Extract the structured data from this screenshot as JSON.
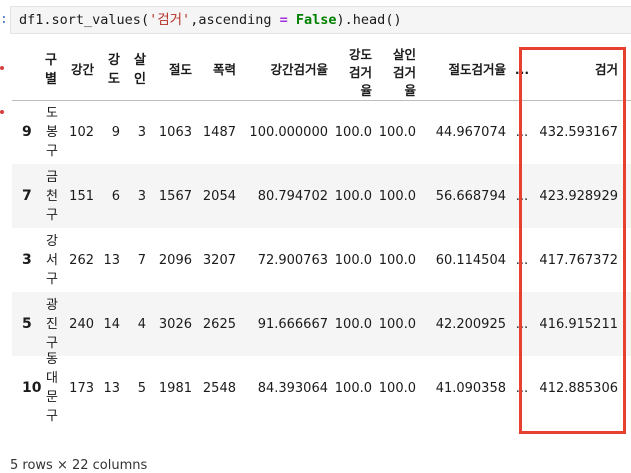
{
  "code": {
    "prompt": ":",
    "tokens": [
      "df1",
      ".",
      "sort_values",
      "(",
      "'검거'",
      ",",
      "ascending",
      " = ",
      "False",
      ")",
      ".",
      "head",
      "()"
    ]
  },
  "table": {
    "header": {
      "index_label": "구별",
      "columns": [
        "강간",
        "강도",
        "살인",
        "절도",
        "폭력",
        "강간검거율",
        "강도검거율",
        "살인검거율",
        "절도검거율",
        "...",
        "검거"
      ]
    },
    "rows": [
      {
        "index": "9",
        "district": "도봉구",
        "values": [
          "102",
          "9",
          "3",
          "1063",
          "1487",
          "100.000000",
          "100.0",
          "100.0",
          "44.967074",
          "...",
          "432.593167"
        ]
      },
      {
        "index": "7",
        "district": "금천구",
        "values": [
          "151",
          "6",
          "3",
          "1567",
          "2054",
          "80.794702",
          "100.0",
          "100.0",
          "56.668794",
          "...",
          "423.928929"
        ]
      },
      {
        "index": "3",
        "district": "강서구",
        "values": [
          "262",
          "13",
          "7",
          "2096",
          "3207",
          "72.900763",
          "100.0",
          "100.0",
          "60.114504",
          "...",
          "417.767372"
        ]
      },
      {
        "index": "5",
        "district": "광진구",
        "values": [
          "240",
          "14",
          "4",
          "3026",
          "2625",
          "91.666667",
          "100.0",
          "100.0",
          "42.200925",
          "...",
          "416.915211"
        ]
      },
      {
        "index": "10",
        "district": "동대문구",
        "values": [
          "173",
          "13",
          "5",
          "1981",
          "2548",
          "84.393064",
          "100.0",
          "100.0",
          "41.090358",
          "...",
          "412.885306"
        ]
      }
    ],
    "footer": "5 rows × 22 columns"
  },
  "colors": {
    "highlight": "#e8402f",
    "string": "#b5322b",
    "keyword": "#008000",
    "operator": "#a22fdc"
  }
}
